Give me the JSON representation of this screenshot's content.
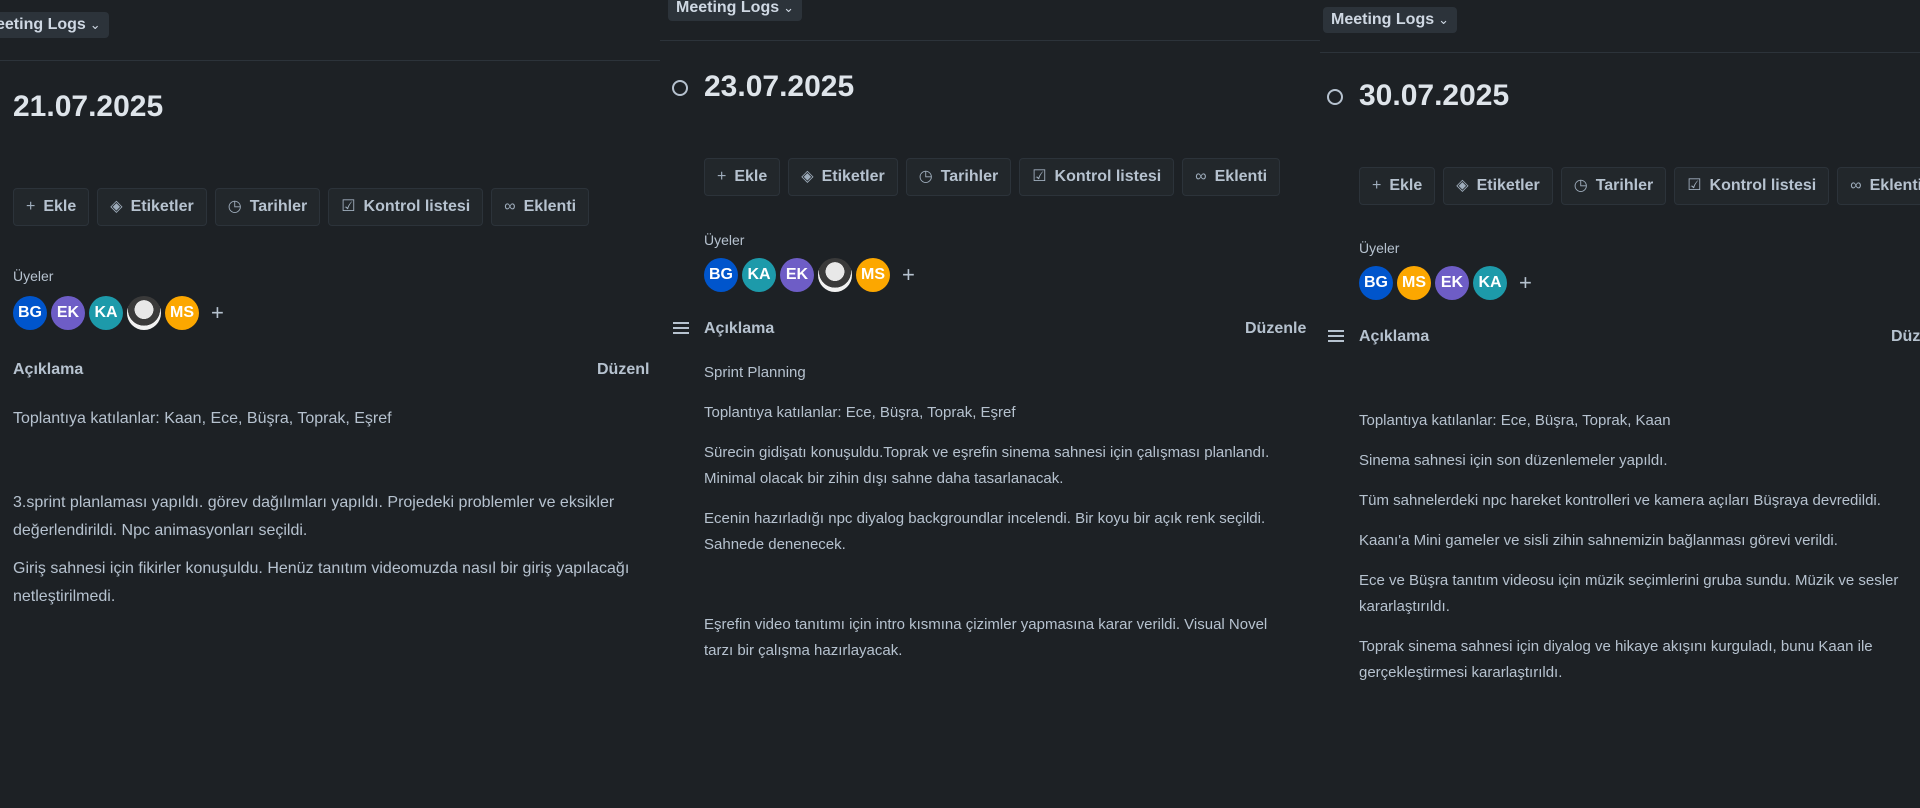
{
  "colors": {
    "bg": "#1d2125",
    "text": "#b6c2cf",
    "bg_alt": "#22272b"
  },
  "actions": [
    {
      "label": "Ekle",
      "icon": "plus-icon"
    },
    {
      "label": "Etiketler",
      "icon": "tag-icon"
    },
    {
      "label": "Tarihler",
      "icon": "clock-icon"
    },
    {
      "label": "Kontrol listesi",
      "icon": "checklist-icon"
    },
    {
      "label": "Eklenti",
      "icon": "paperclip-icon"
    }
  ],
  "members_label": "Üyeler",
  "description_label": "Açıklama",
  "panels": [
    {
      "breadcrumb": "eeting Logs",
      "date": "21.07.2025",
      "edit_label": "Düzenl",
      "members": [
        {
          "initials": "BG",
          "color": "#0055cc"
        },
        {
          "initials": "EK",
          "color": "#6e5dc6"
        },
        {
          "initials": "KA",
          "color": "#1d9aaa"
        },
        {
          "initials": "",
          "color": "photo"
        },
        {
          "initials": "MS",
          "color": "#fca700"
        }
      ],
      "paragraphs": [
        "Toplantıya katılanlar:  Kaan, Ece, Büşra, Toprak, Eşref",
        "",
        "3.sprint planlaması yapıldı. görev dağılımları yapıldı. Projedeki problemler ve eksikler değerlendirildi. Npc animasyonları seçildi.",
        "Giriş sahnesi için fikirler konuşuldu. Henüz tanıtım videomuzda nasıl bir giriş yapılacağı netleştirilmedi."
      ]
    },
    {
      "breadcrumb": "Meeting Logs",
      "date": "23.07.2025",
      "edit_label": "Düzenle",
      "members": [
        {
          "initials": "BG",
          "color": "#0055cc"
        },
        {
          "initials": "KA",
          "color": "#1d9aaa"
        },
        {
          "initials": "EK",
          "color": "#6e5dc6"
        },
        {
          "initials": "",
          "color": "photo"
        },
        {
          "initials": "MS",
          "color": "#fca700"
        }
      ],
      "paragraphs": [
        "Sprint Planning",
        "Toplantıya katılanlar: Ece, Büşra, Toprak, Eşref",
        "Sürecin gidişatı konuşuldu.Toprak ve eşrefin sinema sahnesi için çalışması planlandı. Minimal olacak bir zihin dışı sahne daha tasarlanacak.",
        "Ecenin hazırladığı npc diyalog backgroundlar incelendi. Bir koyu bir açık renk seçildi. Sahnede denenecek.",
        "",
        "Eşrefin video tanıtımı için intro kısmına çizimler yapmasına karar verildi. Visual Novel tarzı bir çalışma hazırlayacak."
      ]
    },
    {
      "breadcrumb": "Meeting Logs",
      "date": "30.07.2025",
      "edit_label": "Düz",
      "members": [
        {
          "initials": "BG",
          "color": "#0055cc"
        },
        {
          "initials": "MS",
          "color": "#fca700"
        },
        {
          "initials": "EK",
          "color": "#6e5dc6"
        },
        {
          "initials": "KA",
          "color": "#1d9aaa"
        }
      ],
      "paragraphs": [
        "Toplantıya katılanlar: Ece, Büşra, Toprak, Kaan",
        "Sinema sahnesi için son düzenlemeler yapıldı.",
        "Tüm sahnelerdeki npc hareket kontrolleri ve kamera açıları Büşraya devredildi.",
        "Kaanı'a Mini gameler ve sisli zihin sahnemizin bağlanması görevi verildi.",
        "Ece ve Büşra tanıtım videosu için müzik seçimlerini gruba sundu. Müzik ve sesler kararlaştırıldı.",
        "Toprak sinema sahnesi için diyalog ve hikaye akışını kurguladı, bunu Kaan ile gerçekleştirmesi kararlaştırıldı."
      ]
    }
  ]
}
